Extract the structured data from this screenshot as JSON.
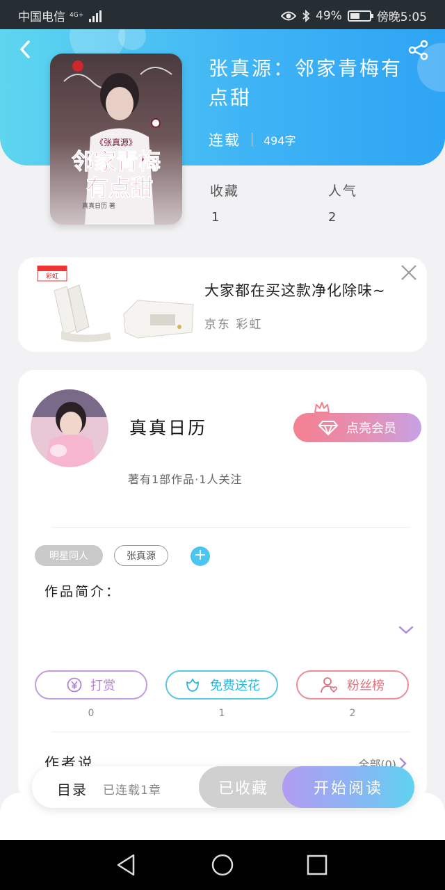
{
  "status_bar": {
    "carrier": "中国电信",
    "network": "4G+",
    "battery_text": "49%",
    "time_text": "傍晚5:05"
  },
  "book": {
    "title": "张真源：邻家青梅有点甜",
    "serial_status": "连载",
    "word_count": "494字",
    "stats": {
      "collect_label": "收藏",
      "collect_value": "1",
      "popularity_label": "人气",
      "popularity_value": "2"
    },
    "cover": {
      "series_text": "《张真源》",
      "title_line1": "邻家青梅",
      "title_line2": "有点甜",
      "author_text": "真真日历 著"
    }
  },
  "ad": {
    "title": "大家都在买这款净化除味~",
    "source": "京东 彩虹",
    "brand_text": "彩虹"
  },
  "author": {
    "name": "真真日历",
    "meta": "著有1部作品·1人关注",
    "vip_button": "点亮会员"
  },
  "tags": [
    "明星同人",
    "张真源"
  ],
  "intro_label": "作品简介：",
  "actions": {
    "reward": {
      "label": "打赏",
      "count": "0"
    },
    "flower": {
      "label": "免费送花",
      "count": "1"
    },
    "fans": {
      "label": "粉丝榜",
      "count": "2"
    }
  },
  "author_says": {
    "label": "作者说",
    "all_link": "全部(0)"
  },
  "bottom_bar": {
    "toc_label": "目录",
    "toc_status": "已连载1章",
    "collect_button": "已收藏",
    "read_button": "开始阅读"
  },
  "colors": {
    "header_blue": "#3fb4f5",
    "accent_cyan": "#4cc6f0",
    "vip_pink": "#f57f8f",
    "reward_purple": "#b184d6",
    "fans_red": "#e0707c"
  }
}
